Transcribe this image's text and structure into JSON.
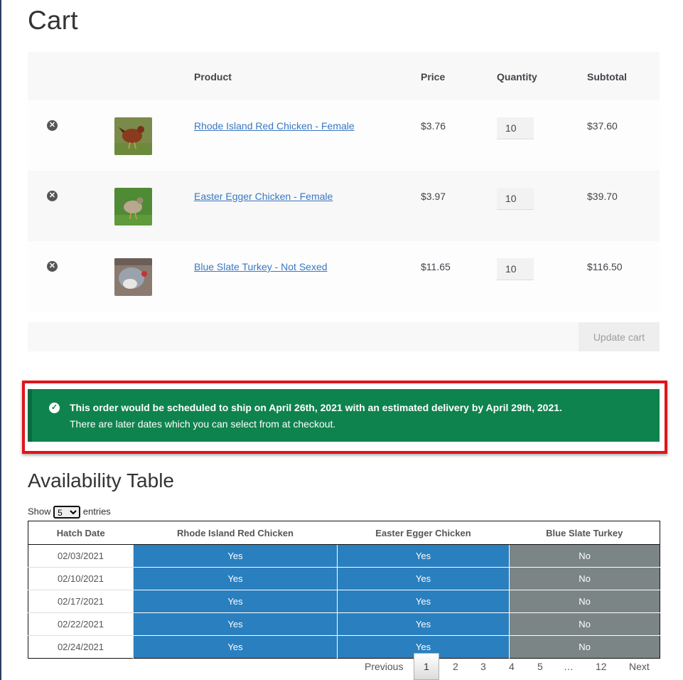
{
  "page": {
    "title": "Cart"
  },
  "cart": {
    "headers": {
      "product": "Product",
      "price": "Price",
      "quantity": "Quantity",
      "subtotal": "Subtotal"
    },
    "items": [
      {
        "name": "Rhode Island Red Chicken - Female",
        "price": "$3.76",
        "quantity": "10",
        "subtotal": "$37.60"
      },
      {
        "name": "Easter Egger Chicken - Female",
        "price": "$3.97",
        "quantity": "10",
        "subtotal": "$39.70"
      },
      {
        "name": "Blue Slate Turkey - Not Sexed",
        "price": "$11.65",
        "quantity": "10",
        "subtotal": "$116.50"
      }
    ],
    "update_label": "Update cart"
  },
  "notice": {
    "line1": "This order would be scheduled to ship on April 26th, 2021 with an estimated delivery by April 29th, 2021.",
    "line2": "There are later dates which you can select from at checkout."
  },
  "availability": {
    "title": "Availability Table",
    "show_label": "Show",
    "entries_label": "entries",
    "page_size": "5",
    "headers": {
      "date": "Hatch Date",
      "col1": "Rhode Island Red Chicken",
      "col2": "Easter Egger Chicken",
      "col3": "Blue Slate Turkey"
    },
    "rows": [
      {
        "date": "02/03/2021",
        "col1": "Yes",
        "col2": "Yes",
        "col3": "No"
      },
      {
        "date": "02/10/2021",
        "col1": "Yes",
        "col2": "Yes",
        "col3": "No"
      },
      {
        "date": "02/17/2021",
        "col1": "Yes",
        "col2": "Yes",
        "col3": "No"
      },
      {
        "date": "02/22/2021",
        "col1": "Yes",
        "col2": "Yes",
        "col3": "No"
      },
      {
        "date": "02/24/2021",
        "col1": "Yes",
        "col2": "Yes",
        "col3": "No"
      }
    ]
  },
  "pagination": {
    "previous": "Previous",
    "pages": [
      "1",
      "2",
      "3",
      "4",
      "5"
    ],
    "ellipsis": "…",
    "last": "12",
    "next": "Next"
  },
  "colors": {
    "notice_bg": "#0f834d",
    "yes_bg": "#2a7fbf",
    "no_bg": "#7c8585",
    "highlight": "#e0141b",
    "link": "#3a77c2"
  },
  "icons": {
    "remove": "remove-circle-icon",
    "notice": "check-circle-icon"
  }
}
